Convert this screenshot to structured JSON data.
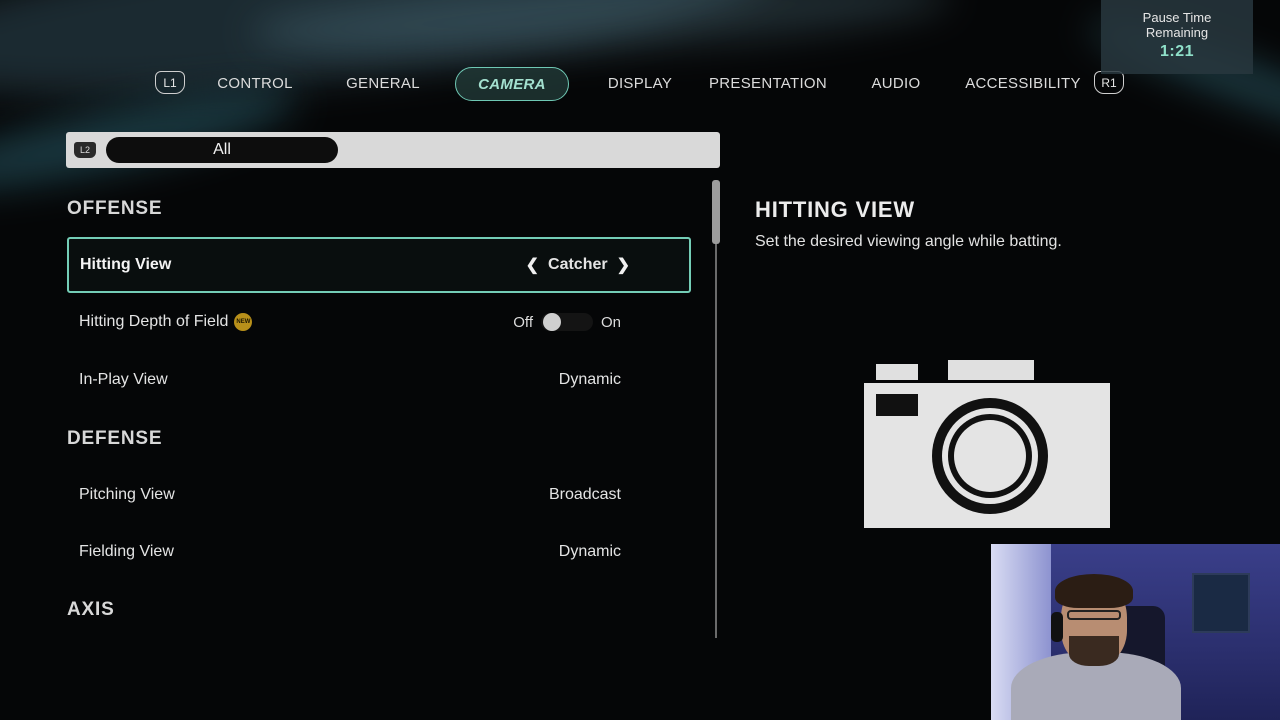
{
  "tabs": {
    "left_bumper": "L1",
    "right_bumper": "R1",
    "items": [
      {
        "label": "CONTROL"
      },
      {
        "label": "GENERAL"
      },
      {
        "label": "CAMERA",
        "active": true
      },
      {
        "label": "DISPLAY"
      },
      {
        "label": "PRESENTATION"
      },
      {
        "label": "AUDIO"
      },
      {
        "label": "ACCESSIBILITY"
      }
    ]
  },
  "pause_timer": {
    "label_line1": "Pause Time",
    "label_line2": "Remaining",
    "time": "1:21"
  },
  "filter": {
    "bumper": "L2",
    "selected": "All"
  },
  "sections": {
    "offense": "OFFENSE",
    "defense": "DEFENSE",
    "axis": "AXIS"
  },
  "settings": {
    "hitting_view": {
      "label": "Hitting View",
      "value": "Catcher",
      "selected": true
    },
    "hitting_dof": {
      "label": "Hitting Depth of Field",
      "badge": "NEW",
      "off_label": "Off",
      "on_label": "On",
      "state": "off"
    },
    "in_play_view": {
      "label": "In-Play View",
      "value": "Dynamic"
    },
    "pitching_view": {
      "label": "Pitching View",
      "value": "Broadcast"
    },
    "fielding_view": {
      "label": "Fielding View",
      "value": "Dynamic"
    }
  },
  "description": {
    "title": "HITTING VIEW",
    "text": "Set the desired viewing angle while batting."
  },
  "colors": {
    "accent": "#74cdb6",
    "timer": "#8fe0c9",
    "new_badge": "#b8901a"
  },
  "icons": {
    "chevron_left": "chevron-left-icon",
    "chevron_right": "chevron-right-icon",
    "camera": "camera-icon"
  }
}
